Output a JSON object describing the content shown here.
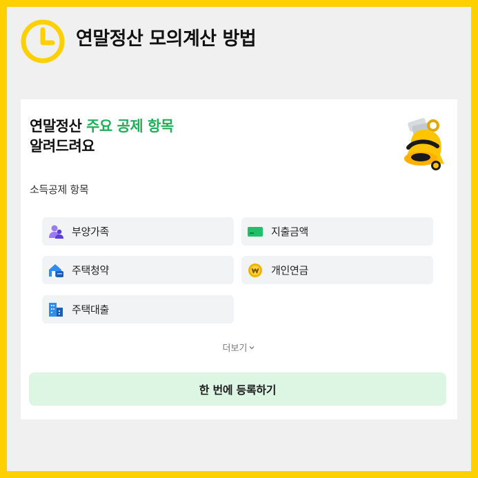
{
  "header": {
    "title": "연말정산 모의계산 방법",
    "icon": "clock-icon",
    "brand_color": "#FFD000"
  },
  "card": {
    "heading_part1": "연말정산 ",
    "heading_accent": "주요 공제 항목",
    "heading_line2": "알려드려요",
    "accent_color": "#1FAE5A",
    "illustration": "bell-icon",
    "section_label": "소득공제 항목",
    "items": [
      {
        "label": "부양가족",
        "icon": "family-icon"
      },
      {
        "label": "지출금액",
        "icon": "card-icon"
      },
      {
        "label": "주택청약",
        "icon": "house-icon"
      },
      {
        "label": "개인연금",
        "icon": "won-coin-icon"
      },
      {
        "label": "주택대출",
        "icon": "building-icon"
      }
    ],
    "more_label": "더보기",
    "cta_label": "한 번에 등록하기"
  }
}
